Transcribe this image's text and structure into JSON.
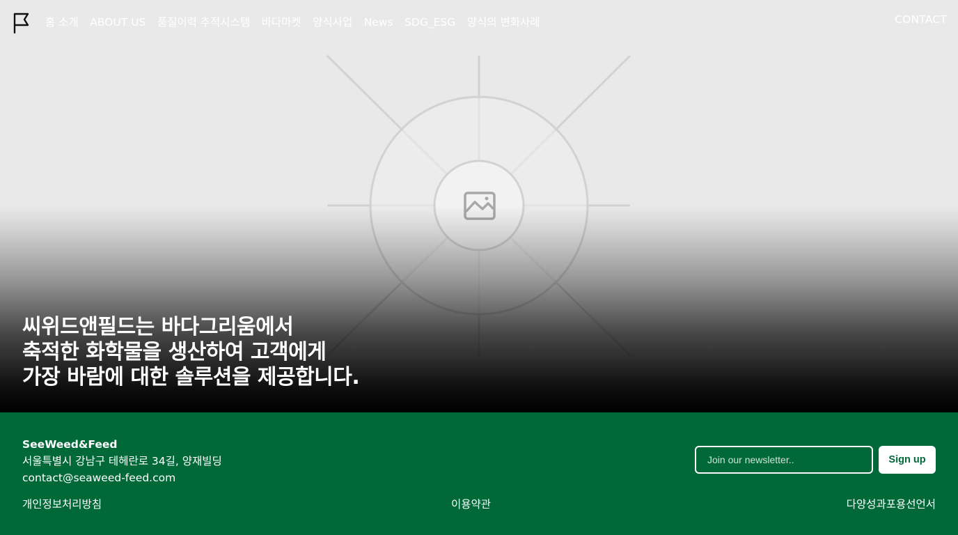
{
  "nav": {
    "logo_icon": "flag-icon",
    "links": [
      "홈 소개",
      "ABOUT US",
      "품질이력 추적시스템",
      "바다마켓",
      "양식사업",
      "News",
      "SDG_ESG",
      "양식의 변화사례"
    ],
    "contact_label": "CONTACT"
  },
  "hero": {
    "image_icon": "image-placeholder-icon",
    "headline_lines": [
      "씨위드앤필드는 바다그리움에서",
      "축적한 화학물을 생산하여 고객에게",
      "가장 바람에 대한 솔루션을 제공합니다."
    ]
  },
  "footer": {
    "company_name": "SeeWeed&Feed",
    "address": "서울특별시 강남구 테헤란로 34길, 양재빌딩",
    "email": "contact@seaweed-feed.com",
    "newsletter_placeholder": "Join our newsletter..",
    "newsletter_value": "",
    "signup_label": "Sign up",
    "links": {
      "privacy": "개인정보처리방침",
      "terms": "이용약관",
      "diversity": "다양성과포용선언서"
    },
    "background_color": "#016938"
  }
}
